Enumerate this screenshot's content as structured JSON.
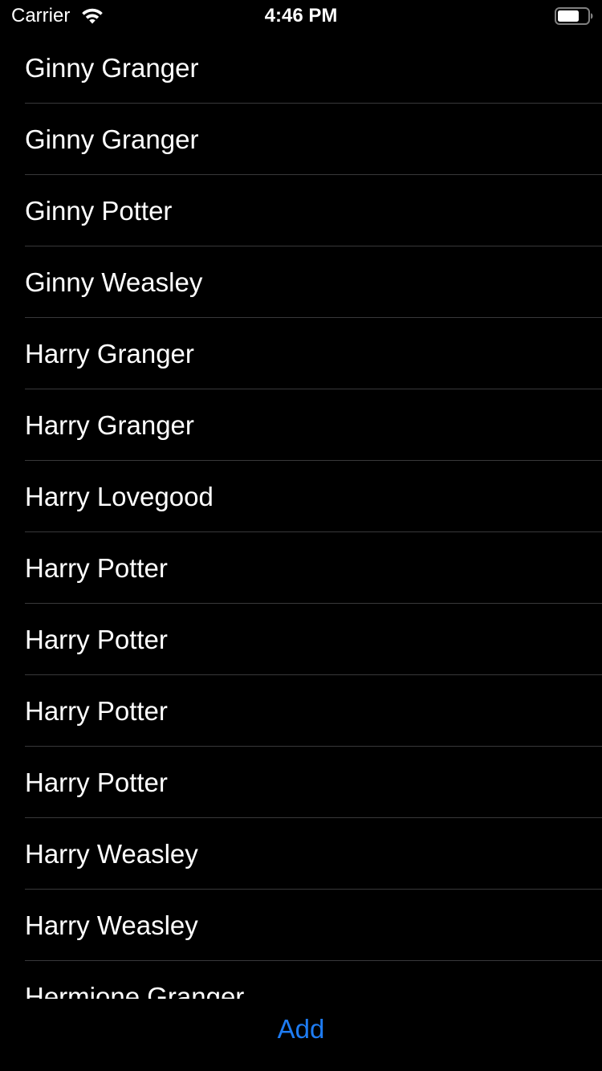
{
  "status_bar": {
    "carrier": "Carrier",
    "time": "4:46 PM",
    "wifi_icon": "wifi-icon",
    "battery_icon": "battery-icon"
  },
  "list": {
    "items": [
      {
        "label": "Ginny Granger"
      },
      {
        "label": "Ginny Granger"
      },
      {
        "label": "Ginny Potter"
      },
      {
        "label": "Ginny Weasley"
      },
      {
        "label": "Harry Granger"
      },
      {
        "label": "Harry Granger"
      },
      {
        "label": "Harry Lovegood"
      },
      {
        "label": "Harry Potter"
      },
      {
        "label": "Harry Potter"
      },
      {
        "label": "Harry Potter"
      },
      {
        "label": "Harry Potter"
      },
      {
        "label": "Harry Weasley"
      },
      {
        "label": "Harry Weasley"
      },
      {
        "label": "Hermione Granger"
      }
    ]
  },
  "toolbar": {
    "add_label": "Add"
  },
  "colors": {
    "background": "#000000",
    "text": "#ffffff",
    "separator": "#38383a",
    "accent": "#1e7cf3"
  }
}
